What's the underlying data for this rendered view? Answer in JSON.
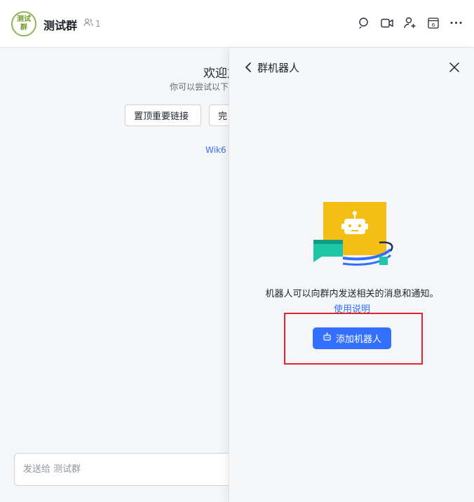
{
  "header": {
    "avatar_text": "测试群",
    "group_name": "测试群",
    "member_count": "1",
    "icons": [
      "search-icon",
      "video-call-icon",
      "add-member-icon",
      "calendar-icon",
      "more-icon"
    ]
  },
  "chat": {
    "welcome_title": "欢迎加",
    "welcome_subtitle": "你可以尝试以下",
    "quick_actions": [
      "置顶重要链接",
      "完"
    ],
    "wiki_link": "Wik6",
    "composer_placeholder": "发送给 测试群"
  },
  "panel": {
    "title": "群机器人",
    "description": "机器人可以向群内发送相关的消息和通知。",
    "usage_link": "使用说明",
    "add_button_label": "添加机器人"
  },
  "colors": {
    "accent": "#3370ff",
    "highlight": "#e0262f",
    "illustration_yellow": "#f5be14",
    "illustration_teal": "#1cc6a6",
    "avatar_green": "#8fb54a"
  }
}
